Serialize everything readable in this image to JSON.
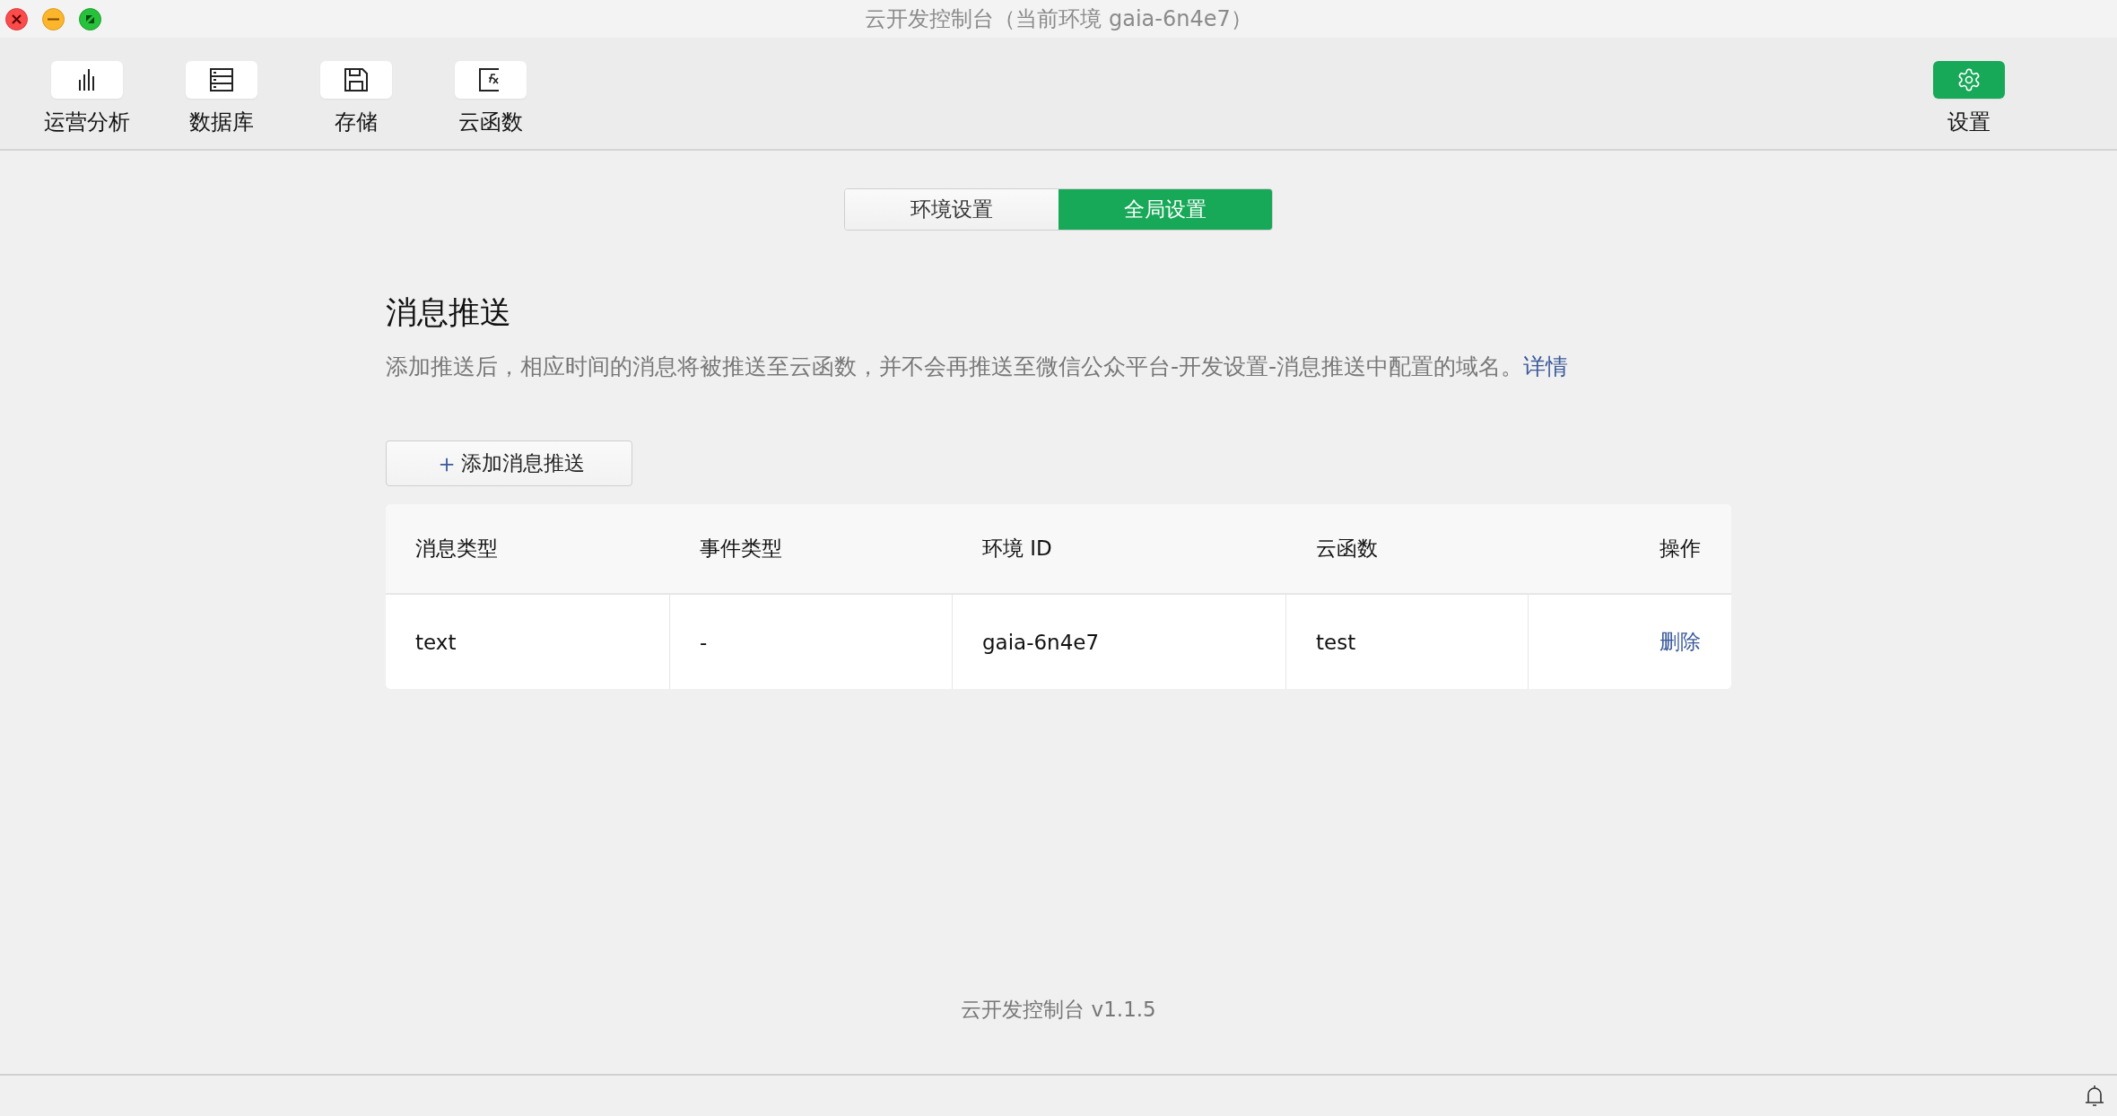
{
  "window": {
    "title": "云开发控制台（当前环境 gaia-6n4e7）"
  },
  "toolbar": {
    "items": [
      {
        "kind": "chart",
        "label": "运营分析",
        "selected": false
      },
      {
        "kind": "database",
        "label": "数据库",
        "selected": false
      },
      {
        "kind": "storage",
        "label": "存储",
        "selected": false
      },
      {
        "kind": "function",
        "label": "云函数",
        "selected": false
      }
    ],
    "settings": {
      "kind": "gear",
      "label": "设置",
      "selected": true
    }
  },
  "tabs": [
    {
      "label": "环境设置",
      "selected": false
    },
    {
      "label": "全局设置",
      "selected": true
    }
  ],
  "section": {
    "title": "消息推送",
    "description": "添加推送后，相应时间的消息将被推送至云函数，并不会再推送至微信公众平台-开发设置-消息推送中配置的域名。",
    "link": "详情",
    "add_button": {
      "icon": "＋",
      "label": "添加消息推送"
    }
  },
  "table": {
    "columns": [
      "消息类型",
      "事件类型",
      "环境 ID",
      "云函数",
      "操作"
    ],
    "rows": [
      {
        "cells": [
          "text",
          "-",
          "gaia-6n4e7",
          "test"
        ],
        "action": "删除"
      }
    ]
  },
  "footer": {
    "version": "云开发控制台 v1.1.5"
  }
}
